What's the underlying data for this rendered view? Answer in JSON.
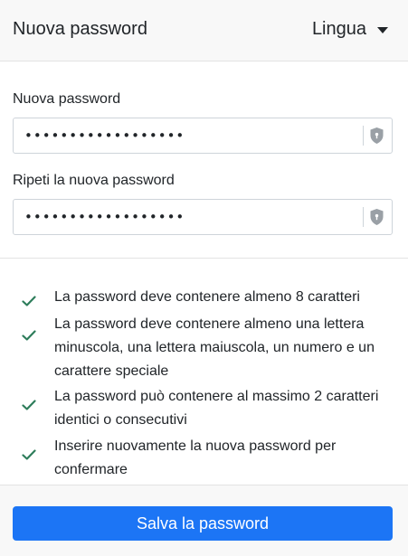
{
  "header": {
    "title": "Nuova password",
    "language_label": "Lingua"
  },
  "form": {
    "new_password": {
      "label": "Nuova password",
      "value": "••••••••••••••••••",
      "toggle_icon": "shield-icon"
    },
    "repeat_password": {
      "label": "Ripeti la nuova password",
      "value": "••••••••••••••••••",
      "toggle_icon": "shield-icon"
    }
  },
  "requirements": [
    {
      "text": "La password deve contenere almeno 8 caratteri",
      "met": true
    },
    {
      "text": "La password deve contenere almeno una lettera minuscola, una lettera maiuscola, un numero e un carattere speciale",
      "met": true
    },
    {
      "text": "La password può contenere al massimo 2 caratteri identici o consecutivi",
      "met": true
    },
    {
      "text": "Inserire nuovamente la nuova password per confermare",
      "met": true
    }
  ],
  "footer": {
    "save_label": "Salva la password"
  },
  "colors": {
    "accent": "#1c75f5",
    "check": "#2e7d5b",
    "header_bg": "#f8f8f8"
  }
}
